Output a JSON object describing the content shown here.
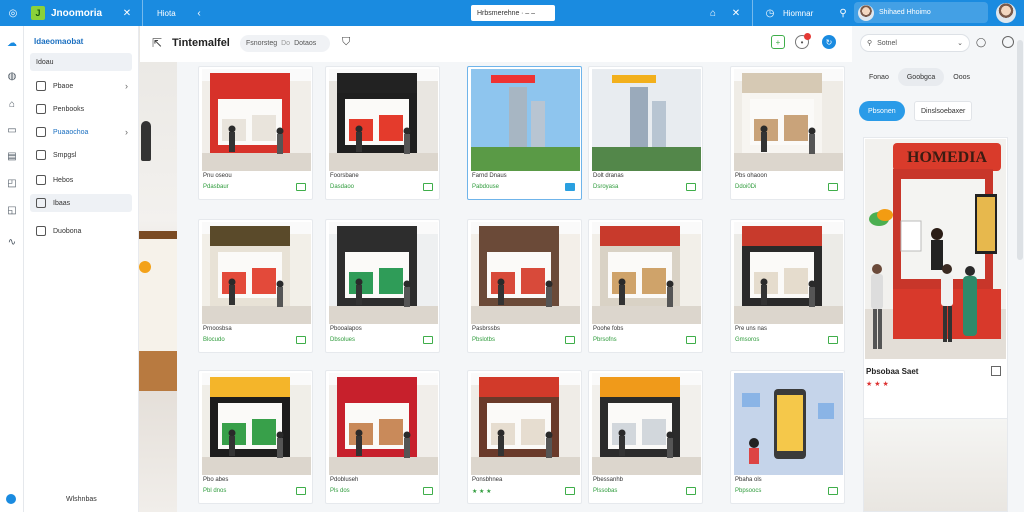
{
  "topbar": {
    "app_name": "Jnoomoria",
    "tab_label": "Hiota",
    "center_field": "Hrbsmerehne ∙ – –",
    "profile_name": "Shihaed Hhoimo",
    "secondary_label": "Hiomnar"
  },
  "nav": {
    "title": "Idaeomaobat",
    "items": [
      {
        "label": "Idoau",
        "icon": "none-icon"
      },
      {
        "label": "Pbaoe",
        "icon": "list-icon"
      },
      {
        "label": "Penbooks",
        "icon": "document-icon"
      },
      {
        "label": "Puaaochoa",
        "icon": "tag-icon"
      },
      {
        "label": "Smpgsl",
        "icon": "folder-icon"
      },
      {
        "label": "Hebos",
        "icon": "calendar-icon"
      },
      {
        "label": "Ibaas",
        "icon": "page-icon"
      },
      {
        "label": "Duobona",
        "icon": "grid-icon"
      }
    ],
    "footer": "Wlshnbas"
  },
  "toolbar": {
    "title": "Tintemalfel",
    "pill_a": "Fsnorsteg",
    "pill_b": "Dotaos",
    "pill_b_prefix": "Do"
  },
  "cards": [
    {
      "title": "Pnu oseou",
      "price": "Pdasbaur",
      "theme": "red",
      "hl": false
    },
    {
      "title": "Foorsbane",
      "price": "Dasdaoo",
      "theme": "dark",
      "hl": false
    },
    {
      "title": "Farnd Dnaus",
      "price": "Pabdouse",
      "theme": "city",
      "hl": true
    },
    {
      "title": "Dolt dranas",
      "price": "Dsroyasa",
      "theme": "city2",
      "hl": false
    },
    {
      "title": "Pbs ohaoon",
      "price": "Ddoi0Di",
      "theme": "mall",
      "hl": false
    },
    {
      "title": "Prnoosbsa",
      "price": "Blocudo",
      "theme": "store",
      "hl": false
    },
    {
      "title": "Pbooalapos",
      "price": "Dbsolues",
      "theme": "store2",
      "hl": false
    },
    {
      "title": "Pasbrssbs",
      "price": "Pbslotbs",
      "theme": "store3",
      "hl": false
    },
    {
      "title": "Poohe fobs",
      "price": "Pbrsofns",
      "theme": "store4",
      "hl": false
    },
    {
      "title": "Pre uns nas",
      "price": "Gmsoros",
      "theme": "store5",
      "hl": false
    },
    {
      "title": "Pbo abes",
      "price": "Pbl dnos",
      "theme": "store6",
      "hl": false
    },
    {
      "title": "Pdobluseh",
      "price": "Pls dos",
      "theme": "red2",
      "hl": false
    },
    {
      "title": "Ponsbhnea",
      "price": "★ ★ ★",
      "theme": "mall2",
      "hl": false
    },
    {
      "title": "Pbessanhb",
      "price": "Plssobas",
      "theme": "mall3",
      "hl": false
    },
    {
      "title": "Pbaha ols",
      "price": "Pbpsoocs",
      "theme": "phone",
      "hl": false
    }
  ],
  "rpanel": {
    "search_placeholder": "Sotnel",
    "tabs": [
      "Fonao",
      "Goobgca",
      "Ooos"
    ],
    "primary_btn": "Pbsonen",
    "ghost_btn": "Dinslsoebaxer",
    "feature_title": "Pbsobaa Saet",
    "feature_meta": "★ ★ ★",
    "feature_sign": "HOMEDIA"
  }
}
